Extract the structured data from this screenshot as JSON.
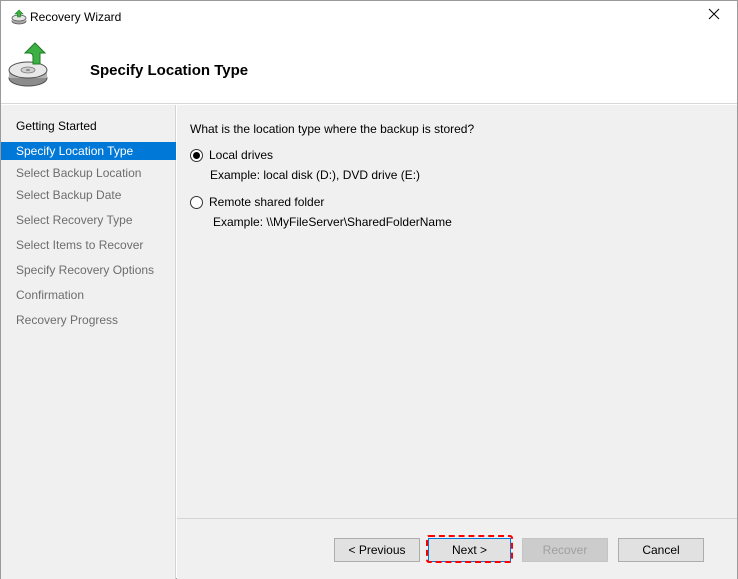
{
  "window": {
    "title": "Recovery Wizard"
  },
  "header": {
    "title": "Specify Location Type"
  },
  "sidebar": {
    "items": [
      {
        "label": "Getting Started",
        "state": "done"
      },
      {
        "label": "Specify Location Type",
        "state": "active"
      },
      {
        "label": "Select Backup Location",
        "state": "pending"
      },
      {
        "label": "Select Backup Date",
        "state": "pending"
      },
      {
        "label": "Select Recovery Type",
        "state": "pending"
      },
      {
        "label": "Select Items to Recover",
        "state": "pending"
      },
      {
        "label": "Specify Recovery Options",
        "state": "pending"
      },
      {
        "label": "Confirmation",
        "state": "pending"
      },
      {
        "label": "Recovery Progress",
        "state": "pending"
      }
    ]
  },
  "main": {
    "question": "What is the location type where the backup is stored?",
    "options": [
      {
        "label": "Local drives",
        "example": "Example: local disk (D:), DVD drive (E:)",
        "selected": true
      },
      {
        "label": "Remote shared folder",
        "example": "Example: \\\\MyFileServer\\SharedFolderName",
        "selected": false
      }
    ]
  },
  "footer": {
    "previous_label": "< Previous",
    "next_label": "Next >",
    "recover_label": "Recover",
    "cancel_label": "Cancel",
    "recover_enabled": false
  },
  "colors": {
    "accent": "#0078d7",
    "highlight": "#ff0000",
    "panel_bg": "#f0f0f0"
  },
  "icons": {
    "app": "backup-restore-icon",
    "header": "disk-restore-icon",
    "close": "close-icon"
  }
}
